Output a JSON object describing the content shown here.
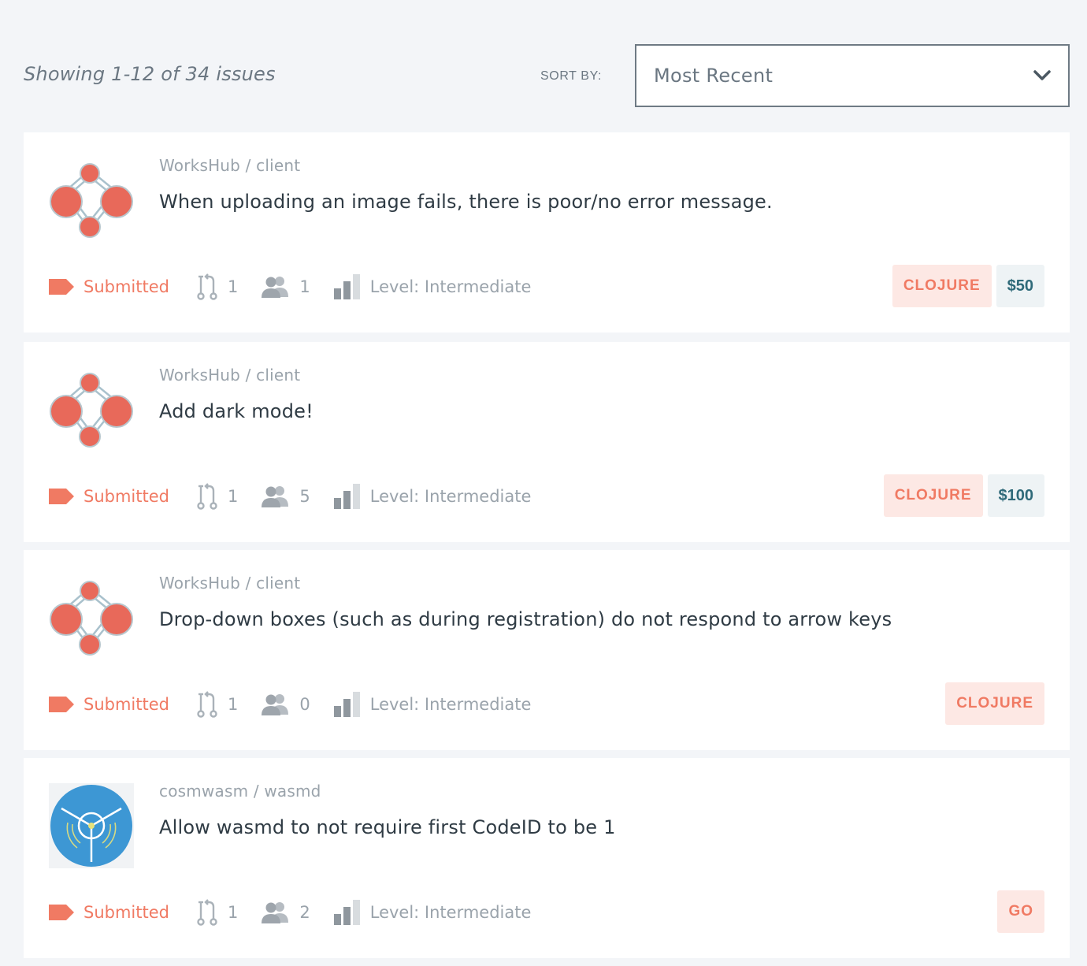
{
  "header": {
    "summary": "Showing 1-12 of 34 issues",
    "sort_label": "SORT BY:",
    "sort_value": "Most Recent"
  },
  "colors": {
    "accent": "#f07a63",
    "tag_bg": "#fde8e4",
    "reward_text": "#2f6a79",
    "reward_bg": "#eef3f5",
    "page_bg": "#f3f5f8"
  },
  "issues": [
    {
      "owner": "WorksHub",
      "sep": " / ",
      "repo": "client",
      "logo": "workshub-logo",
      "title": "When uploading an image fails, there is poor/no error message.",
      "status": "Submitted",
      "prs": "1",
      "contributors": "1",
      "level": "Level: Intermediate",
      "tag": "CLOJURE",
      "reward": "$50"
    },
    {
      "owner": "WorksHub",
      "sep": " / ",
      "repo": "client",
      "logo": "workshub-logo",
      "title": "Add dark mode!",
      "status": "Submitted",
      "prs": "1",
      "contributors": "5",
      "level": "Level: Intermediate",
      "tag": "CLOJURE",
      "reward": "$100"
    },
    {
      "owner": "WorksHub",
      "sep": " / ",
      "repo": "client",
      "logo": "workshub-logo",
      "title": "Drop-down boxes (such as during registration) do not respond to arrow keys",
      "status": "Submitted",
      "prs": "1",
      "contributors": "0",
      "level": "Level: Intermediate",
      "tag": "CLOJURE",
      "reward": ""
    },
    {
      "owner": "cosmwasm",
      "sep": " / ",
      "repo": "wasmd",
      "logo": "cosmwasm-logo",
      "title": "Allow wasmd to not require first CodeID to be 1",
      "status": "Submitted",
      "prs": "1",
      "contributors": "2",
      "level": "Level: Intermediate",
      "tag": "GO",
      "reward": ""
    }
  ]
}
